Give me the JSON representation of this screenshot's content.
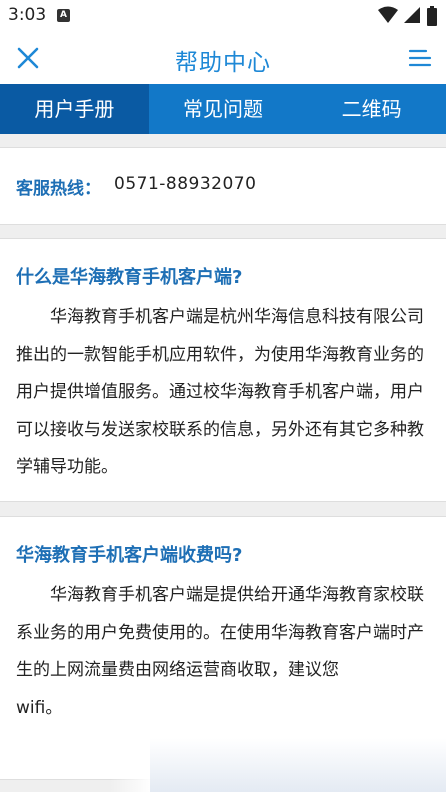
{
  "status_bar": {
    "time": "3:03",
    "notification_letter": "A"
  },
  "header": {
    "title": "帮助中心",
    "close_icon": "close-icon",
    "menu_icon": "menu-icon",
    "accent_color": "#1e88d6"
  },
  "tabs": [
    {
      "label": "用户手册",
      "active": true
    },
    {
      "label": "常见问题",
      "active": false
    },
    {
      "label": "二维码",
      "active": false
    }
  ],
  "hotline": {
    "label": "客服热线：",
    "number": "0571-88932070"
  },
  "faqs": [
    {
      "question": "什么是华海教育手机客户端?",
      "answer": "华海教育手机客户端是杭州华海信息科技有限公司推出的一款智能手机应用软件，为使用华海教育业务的用户提供增值服务。通过校华海教育手机客户端，用户可以接收与发送家校联系的信息，另外还有其它多种教学辅导功能。"
    },
    {
      "question": "华海教育手机客户端收费吗?",
      "answer": "华海教育手机客户端是提供给开通华海教育家校联系业务的用户免费使用的。在使用华海教育客户端时产生的上网流量费由网络运营商收取，建议您",
      "answer_tail": "wifi。"
    }
  ],
  "colors": {
    "tab_bar": "#1278c8",
    "tab_active": "#0a5aa3",
    "question_text": "#1e6fb5"
  }
}
